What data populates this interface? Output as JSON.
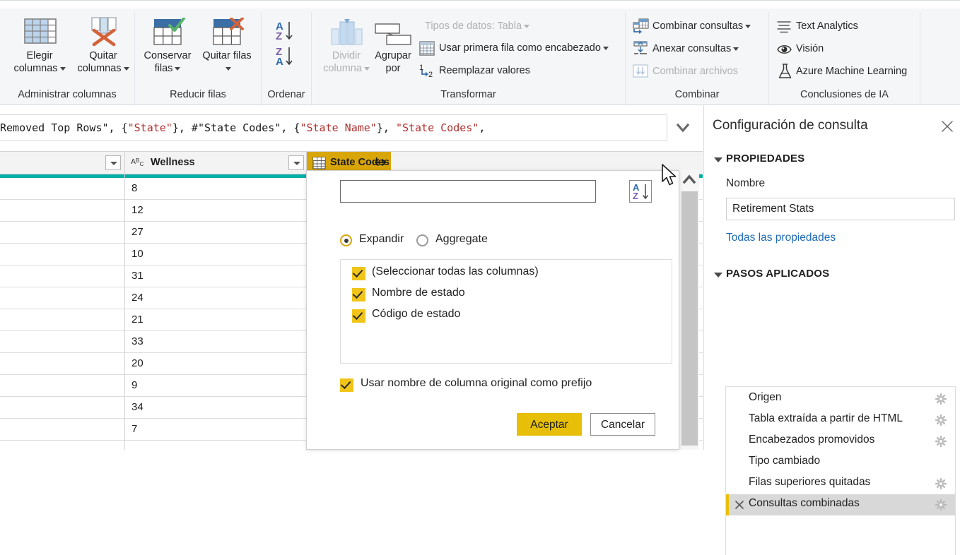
{
  "ribbon": {
    "groups": [
      {
        "label": "Administrar columnas"
      },
      {
        "label": "Reducir filas"
      },
      {
        "label": "Ordenar"
      },
      {
        "label": "Transformar"
      },
      {
        "label": "Combinar"
      },
      {
        "label": "Conclusiones de IA"
      }
    ],
    "manage_columns": {
      "choose_columns": "Elegir\ncolumnas",
      "choose_columns_l1": "Elegir",
      "choose_columns_l2": "columnas",
      "remove_columns_l1": "Quitar",
      "remove_columns_l2": "columnas"
    },
    "reduce_rows": {
      "keep_rows_l1": "Conservar",
      "keep_rows_l2": "filas",
      "remove_rows_l1": "Quitar filas"
    },
    "sort": {
      "asc": "A-Z ascendente",
      "desc": "Z-A descendente"
    },
    "transform": {
      "split_column_l1": "Dividir",
      "split_column_l2": "columna",
      "group_by_l1": "Agrupar",
      "group_by_l2": "por",
      "data_type": "Tipos de datos: Tabla",
      "first_row_header": "Usar primera fila como encabezado",
      "replace_values": "Reemplazar valores"
    },
    "combine": {
      "merge_queries": "Combinar consultas",
      "append_queries": "Anexar consultas",
      "combine_files": "Combinar archivos"
    },
    "ai_insights": {
      "text_analytics": "Text Analytics",
      "vision": "Visión",
      "azure_ml": "Azure Machine Learning"
    }
  },
  "formula_bar": {
    "segments": [
      {
        "t": "Removed Top Rows\", {",
        "c": "pl"
      },
      {
        "t": "\"State\"",
        "c": "str"
      },
      {
        "t": "}, #",
        "c": "pl"
      },
      {
        "t": "\"State Codes\"",
        "c": "pl"
      },
      {
        "t": ", {",
        "c": "pl"
      },
      {
        "t": "\"State Name\"",
        "c": "str"
      },
      {
        "t": "}, ",
        "c": "pl"
      },
      {
        "t": "\"State Codes\"",
        "c": "str"
      },
      {
        "t": ",",
        "c": "pl"
      }
    ],
    "chevron_icon": "chevron-down-icon"
  },
  "grid": {
    "columns": [
      {
        "name": "",
        "type_icon": "",
        "selected": false
      },
      {
        "name": "Wellness",
        "type_icon": "ABC",
        "selected": false
      },
      {
        "name": "State Codes",
        "type_icon": "table-icon",
        "selected": true
      }
    ],
    "rows": [
      {
        "wellness": "8"
      },
      {
        "wellness": "12"
      },
      {
        "wellness": "27"
      },
      {
        "wellness": "10"
      },
      {
        "wellness": "31"
      },
      {
        "wellness": "24"
      },
      {
        "wellness": "21"
      },
      {
        "wellness": "33"
      },
      {
        "wellness": "20"
      },
      {
        "wellness": "9"
      },
      {
        "wellness": "34"
      },
      {
        "wellness": "7"
      }
    ]
  },
  "expand_dialog": {
    "search_value": "",
    "search_placeholder": "",
    "sort_icon": "sort-az-icon",
    "mode_expand": "Expandir",
    "mode_aggregate": "Aggregate",
    "selected_mode": "Expandir",
    "columns": [
      {
        "label": "(Seleccionar todas las columnas)",
        "checked": true
      },
      {
        "label": "Nombre de estado",
        "checked": true
      },
      {
        "label": "Código de estado",
        "checked": true
      }
    ],
    "prefix_label": "Usar nombre de columna original como prefijo",
    "prefix_checked": true,
    "ok_label": "Aceptar",
    "cancel_label": "Cancelar"
  },
  "query_settings": {
    "title": "Configuración de consulta",
    "close_icon": "close-icon",
    "properties_header": "PROPIEDADES",
    "name_label": "Nombre",
    "name_value": "Retirement Stats",
    "all_properties_link": "Todas las propiedades",
    "applied_steps_header": "PASOS APLICADOS",
    "steps": [
      {
        "label": "Origen",
        "gear": true,
        "selected": false,
        "deletable": false
      },
      {
        "label": "Tabla extraída a partir de HTML",
        "gear": true,
        "selected": false,
        "deletable": false
      },
      {
        "label": "Encabezados promovidos",
        "gear": true,
        "selected": false,
        "deletable": false
      },
      {
        "label": "Tipo cambiado",
        "gear": false,
        "selected": false,
        "deletable": false
      },
      {
        "label": "Filas superiores quitadas",
        "gear": true,
        "selected": false,
        "deletable": false
      },
      {
        "label": "Consultas combinadas",
        "gear": true,
        "selected": true,
        "deletable": true
      }
    ]
  },
  "colors": {
    "accent_gold": "#e8bf08",
    "header_selected": "#d9a60a",
    "selection_teal": "#00b0a6",
    "link_blue": "#1f6bb5",
    "ribbon_bg": "#f4f6f8"
  }
}
